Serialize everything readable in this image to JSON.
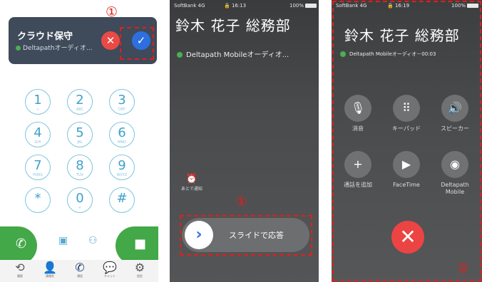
{
  "panel1": {
    "banner": {
      "title": "クラウド保守",
      "subtitle": "Deltapathオーディオ..."
    },
    "decline_glyph": "✕",
    "accept_glyph": "✓",
    "marker": "①",
    "keys": [
      {
        "num": "1",
        "letters": "∞"
      },
      {
        "num": "2",
        "letters": "ABC"
      },
      {
        "num": "3",
        "letters": "DEF"
      },
      {
        "num": "4",
        "letters": "GHI"
      },
      {
        "num": "5",
        "letters": "JKL"
      },
      {
        "num": "6",
        "letters": "MNO"
      },
      {
        "num": "7",
        "letters": "PQRS"
      },
      {
        "num": "8",
        "letters": "TUV"
      },
      {
        "num": "9",
        "letters": "WXYZ"
      },
      {
        "num": "*",
        "letters": ""
      },
      {
        "num": "0",
        "letters": "+"
      },
      {
        "num": "#",
        "letters": ""
      }
    ],
    "tabs": [
      {
        "icon": "history-icon",
        "glyph": "⟲",
        "label": "履歴"
      },
      {
        "icon": "contacts-icon",
        "glyph": "👤",
        "label": "連絡先"
      },
      {
        "icon": "phone-icon",
        "glyph": "✆",
        "label": "通話"
      },
      {
        "icon": "chat-icon",
        "glyph": "💬",
        "label": "チャット"
      },
      {
        "icon": "gear-icon",
        "glyph": "⚙",
        "label": "設定"
      }
    ],
    "colors": {
      "banner": "#3f4a5a",
      "accent_blue": "#2e6fe0",
      "green": "#43a847",
      "red": "#e94a45"
    }
  },
  "panel2": {
    "status": {
      "carrier": "SoftBank 4G",
      "time": "16:13",
      "battery": "100%"
    },
    "caller": "鈴木 花子 総務部",
    "app_line": "Deltapath Mobileオーディオ...",
    "remind_label": "あとで通知",
    "slider_label": "スライドで応答",
    "marker": "①"
  },
  "panel3": {
    "status": {
      "carrier": "SoftBank 4G",
      "time": "16:19",
      "battery": "100%"
    },
    "caller": "鈴木 花子 総務部",
    "app_line": "Deltapath Mobileオーディオ－00:03",
    "controls": [
      {
        "label": "消音",
        "icon": "mute-icon",
        "glyph": "🎙"
      },
      {
        "label": "キーパッド",
        "icon": "keypad-icon",
        "glyph": "⠿"
      },
      {
        "label": "スピーカー",
        "icon": "speaker-icon",
        "glyph": "🔊"
      },
      {
        "label": "通話を追加",
        "icon": "add-call-icon",
        "glyph": "+"
      },
      {
        "label": "FaceTime",
        "icon": "facetime-icon",
        "glyph": "▶"
      },
      {
        "label": "Deltapath Mobile",
        "icon": "deltapath-icon",
        "glyph": "◉"
      }
    ],
    "end_glyph": "✕",
    "marker": "②"
  }
}
